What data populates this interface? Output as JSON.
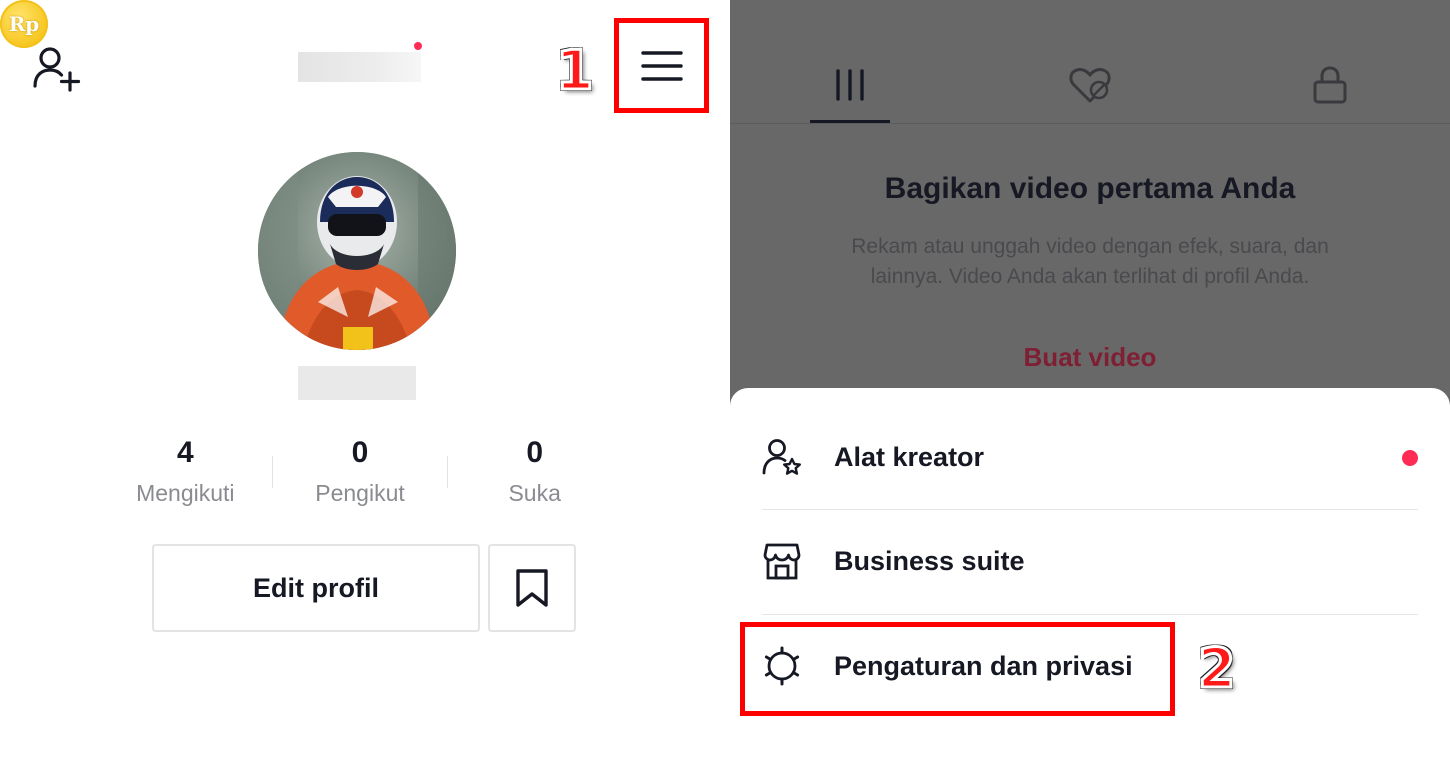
{
  "profile": {
    "coin_label": "Rp",
    "stats": [
      {
        "value": "4",
        "label": "Mengikuti"
      },
      {
        "value": "0",
        "label": "Pengikut"
      },
      {
        "value": "0",
        "label": "Suka"
      }
    ],
    "edit_button": "Edit profil"
  },
  "annotations": {
    "step1": "1",
    "step2": "2",
    "highlight_color": "#ff0000"
  },
  "right_panel": {
    "tabs": [
      {
        "icon": "grid-bars-icon",
        "active": true
      },
      {
        "icon": "liked-hidden-icon",
        "active": false
      },
      {
        "icon": "lock-icon",
        "active": false
      }
    ],
    "empty_title": "Bagikan video pertama Anda",
    "empty_desc": "Rekam atau unggah video dengan efek, suara, dan lainnya. Video Anda akan terlihat di profil Anda.",
    "create_link": "Buat video"
  },
  "menu_sheet": {
    "items": [
      {
        "label": "Alat kreator",
        "icon": "creator-tools-icon",
        "badge": true
      },
      {
        "label": "Business suite",
        "icon": "store-icon",
        "badge": false
      },
      {
        "label": "Pengaturan dan privasi",
        "icon": "settings-gear-icon",
        "badge": false
      }
    ]
  },
  "colors": {
    "accent": "#fe2c55",
    "text_primary": "#161823",
    "text_secondary": "#8a8b91",
    "overlay": "#686868"
  }
}
